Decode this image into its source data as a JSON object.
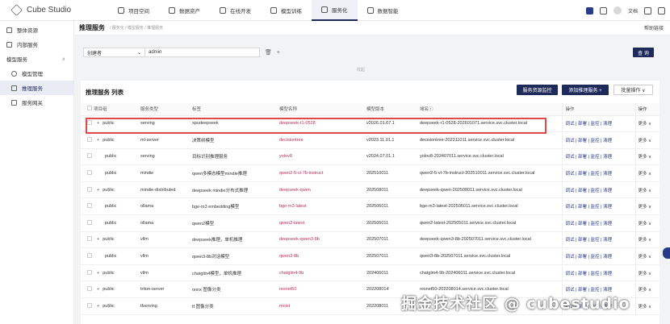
{
  "app": {
    "title": "Cube Studio"
  },
  "nav": [
    {
      "label": "项目空间",
      "active": false
    },
    {
      "label": "数据资产",
      "active": false
    },
    {
      "label": "在线开发",
      "active": false
    },
    {
      "label": "模型训练",
      "active": false
    },
    {
      "label": "服务化",
      "active": true
    },
    {
      "label": "数据智能",
      "active": false
    }
  ],
  "topright": {
    "lang": "文档"
  },
  "sidebar": {
    "items": [
      {
        "label": "整体资源"
      },
      {
        "label": "内部服务"
      },
      {
        "label": "模型服务"
      },
      {
        "label": "模型管理"
      },
      {
        "label": "推理服务"
      },
      {
        "label": "服务网关"
      }
    ]
  },
  "page": {
    "title": "推理服务",
    "breadcrumb": "/ 服务化 / 模型服务 / 推理服务",
    "help": "帮助链接"
  },
  "filter": {
    "field": "创建者",
    "value": "admin",
    "query_label": "查 询",
    "collapse_label": "收起"
  },
  "list": {
    "title": "推理服务 列表",
    "btn_monitor": "服务资源监控",
    "btn_add": "添加推理服务 +",
    "btn_batch": "批量操作 ∨",
    "columns": {
      "project": "项目组",
      "type": "服务类型",
      "label": "标签",
      "model": "模型名称",
      "version": "模型版本",
      "host": "域名ⓘ",
      "ops": "操作",
      "ops2": "操作"
    },
    "ops_text": "调试 | 部署 | 监控 | 清理",
    "more_text": "更多 ∨",
    "rows": [
      {
        "plus": "+",
        "project": "public",
        "type": "serving",
        "label": "xpudeepseek",
        "model": "deepseek-r1-0528",
        "version": "v2026.01.07.1",
        "host": "deepseek-r1-0528-202601071.service.svc.cluster.local"
      },
      {
        "plus": "+",
        "project": "public",
        "type": "ml-server",
        "label": "决策树模型",
        "model": "decisiontree",
        "version": "v2023.11.01.1",
        "host": "decisiontree-202311011.service.svc.cluster.local"
      },
      {
        "plus": "",
        "project": "public",
        "type": "serving",
        "label": "目标识别推理服务",
        "model": "yolov8",
        "version": "v2024.07.01.1",
        "host": "yolov8-202407011.service.svc.cluster.local"
      },
      {
        "plus": "",
        "project": "public",
        "type": "mindie",
        "label": "qwen多模态模型mindie推理",
        "model": "qwen2-5-vl-7b-instruct",
        "version": "202510011",
        "host": "qwen2-5-vl-7b-instruct-202510011.service.svc.cluster.local"
      },
      {
        "plus": "+",
        "project": "public",
        "type": "mindie-distributed",
        "label": "deepseek mindie分布式推理",
        "model": "deepseek-qwen",
        "version": "202508011",
        "host": "deepseek-qwen-202508011.service.svc.cluster.local"
      },
      {
        "plus": "",
        "project": "public",
        "type": "ollama",
        "label": "bge-m3 embedding模型",
        "model": "bge-m3-latest",
        "version": "202506011",
        "host": "bge-m3-latest-202506011.service.svc.cluster.local"
      },
      {
        "plus": "",
        "project": "public",
        "type": "ollama",
        "label": "qwen2模型",
        "model": "qwen2-latest",
        "version": "202505011",
        "host": "qwen2-latest-202505011.service.svc.cluster.local"
      },
      {
        "plus": "+",
        "project": "public",
        "type": "vllm",
        "label": "deepseek推理，单机推理",
        "model": "deepseek-qwen3-8b",
        "version": "202507011",
        "host": "deepseek-qwen3-8b-202507011.service.svc.cluster.local"
      },
      {
        "plus": "",
        "project": "public",
        "type": "vllm",
        "label": "qwen3-8b对话模型",
        "model": "qwen3-8b",
        "version": "202507011",
        "host": "qwen3-8b-202507011.service.svc.cluster.local"
      },
      {
        "plus": "+",
        "project": "public",
        "type": "vllm",
        "label": "chatglm4模型，单机推理",
        "model": "chatglm4-9b",
        "version": "202406011",
        "host": "chatglm4-9b-202406011.service.svc.cluster.local"
      },
      {
        "plus": "+",
        "project": "public",
        "type": "triton-server",
        "label": "onnx 图像分类",
        "model": "resnet50",
        "version": "202208014",
        "host": "resnet50-202208014.service.svc.cluster.local"
      },
      {
        "plus": "+",
        "project": "public",
        "type": "tfserving",
        "label": "tf 图像分类",
        "model": "mnist",
        "version": "202208011",
        "host": ""
      }
    ]
  },
  "watermark": "掘金技术社区 @ cubestudio"
}
